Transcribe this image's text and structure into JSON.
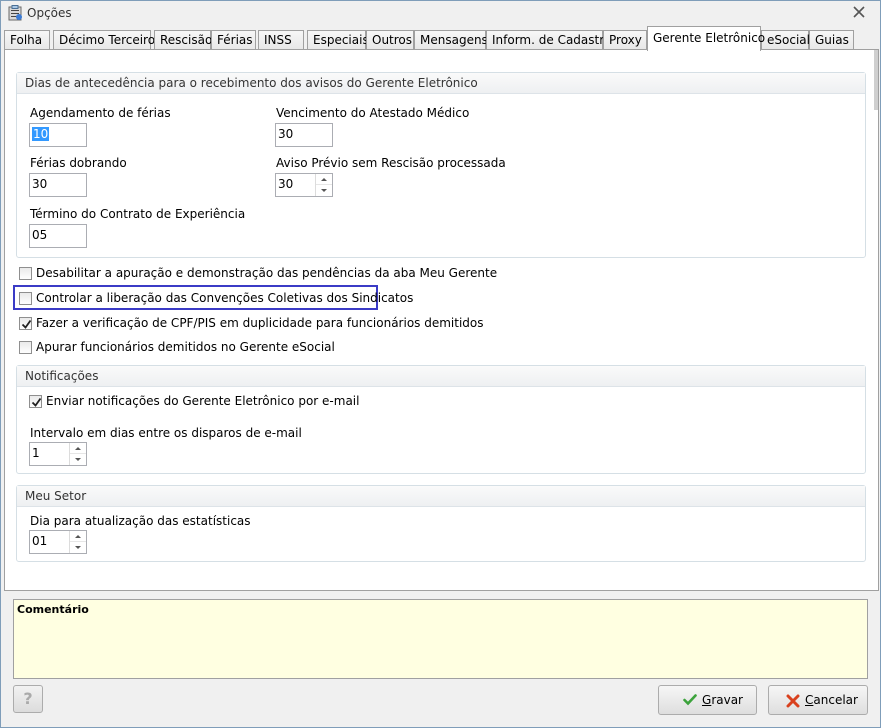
{
  "window": {
    "title": "Opções",
    "title_icon": "clipboard-icon",
    "close_icon": "close-icon"
  },
  "tabs": [
    {
      "label": "Folha"
    },
    {
      "label": "Décimo Terceiro"
    },
    {
      "label": "Rescisão"
    },
    {
      "label": "Férias"
    },
    {
      "label": "INSS"
    },
    {
      "label": "Especiais"
    },
    {
      "label": "Outros"
    },
    {
      "label": "Mensagens"
    },
    {
      "label": "Inform. de Cadastro"
    },
    {
      "label": "Proxy"
    },
    {
      "label": "Gerente Eletrônico",
      "active": true
    },
    {
      "label": "eSocial"
    },
    {
      "label": "Guias"
    }
  ],
  "advance_group": {
    "title": "Dias de antecedência para o recebimento dos avisos do Gerente Eletrônico",
    "vacation_schedule": {
      "label": "Agendamento de férias",
      "value": "10"
    },
    "medical_certificate": {
      "label": "Vencimento do Atestado Médico",
      "value": "30"
    },
    "double_vacation": {
      "label": "Férias dobrando",
      "value": "30"
    },
    "prior_notice": {
      "label": "Aviso Prévio sem Rescisão processada",
      "value": "30"
    },
    "contract_end": {
      "label": "Término do Contrato de Experiência",
      "value": "05"
    }
  },
  "options": [
    {
      "label": "Desabilitar a apuração e demonstração das pendências da aba Meu Gerente",
      "checked": false
    },
    {
      "label": "Controlar a liberação das Convenções Coletivas dos Sindicatos",
      "checked": false
    },
    {
      "label": "Fazer a verificação de CPF/PIS em duplicidade para funcionários demitidos",
      "checked": true
    },
    {
      "label": "Apurar funcionários demitidos no Gerente eSocial",
      "checked": false
    }
  ],
  "notifications": {
    "title": "Notificações",
    "email_checkbox": {
      "label": "Enviar notificações do Gerente Eletrônico por e-mail",
      "checked": true
    },
    "interval": {
      "label": "Intervalo em dias entre os disparos de e-mail",
      "value": "1"
    }
  },
  "my_sector": {
    "title": "Meu Setor",
    "stats_day": {
      "label": "Dia para atualização das estatísticas",
      "value": "01"
    }
  },
  "comment": {
    "label": "Comentário"
  },
  "footer": {
    "help_label": "?",
    "save_prefix": "",
    "save_accel": "G",
    "save_rest": "ravar",
    "cancel_accel": "C",
    "cancel_rest": "ancelar"
  },
  "colors": {
    "highlight": "#3b3bc6",
    "comment_bg": "#ffffe1",
    "selection": "#3399ff"
  }
}
